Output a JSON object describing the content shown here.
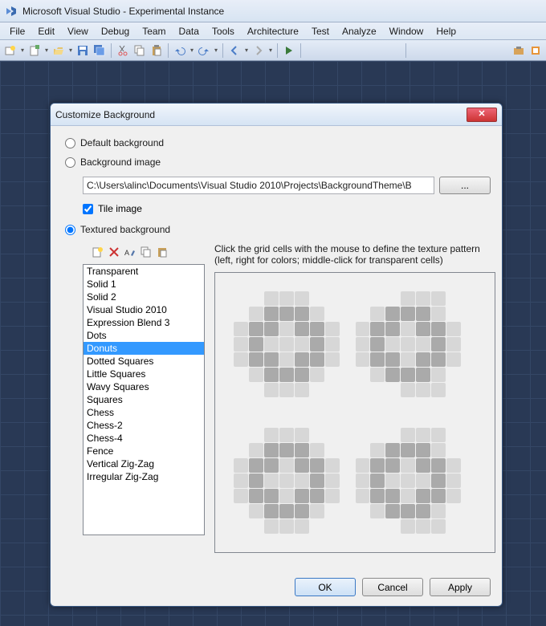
{
  "window": {
    "title": "Microsoft Visual Studio - Experimental Instance"
  },
  "menu": {
    "items": [
      "File",
      "Edit",
      "View",
      "Debug",
      "Team",
      "Data",
      "Tools",
      "Architecture",
      "Test",
      "Analyze",
      "Window",
      "Help"
    ]
  },
  "dialog": {
    "title": "Customize Background",
    "options": {
      "default_label": "Default background",
      "image_label": "Background image",
      "textured_label": "Textured background",
      "selected": "textured"
    },
    "image_path": "C:\\Users\\alinc\\Documents\\Visual Studio 2010\\Projects\\BackgroundTheme\\B",
    "browse_label": "...",
    "tile_label": "Tile image",
    "tile_checked": true,
    "hint": "Click the grid cells with the mouse to define the texture pattern (left, right for colors; middle-click for transparent cells)",
    "presets": [
      "Transparent",
      "Solid 1",
      "Solid 2",
      "Visual Studio 2010",
      "Expression Blend 3",
      "Dots",
      "Donuts",
      "Dotted Squares",
      "Little Squares",
      "Wavy Squares",
      "Squares",
      "Chess",
      "Chess-2",
      "Chess-4",
      "Fence",
      "Vertical Zig-Zag",
      "Irregular Zig-Zag"
    ],
    "selected_preset": "Donuts",
    "buttons": {
      "ok": "OK",
      "cancel": "Cancel",
      "apply": "Apply"
    },
    "grid_pattern": [
      "000000000000000000",
      "000111000000111000",
      "001222100012221000",
      "012212210122122100",
      "012111210121112100",
      "012212210122122100",
      "001222100012221000",
      "000111000000111000",
      "000000000000000000",
      "000000000000000000",
      "000111000000111000",
      "001222100012221000",
      "012212210122122100",
      "012111210121112100",
      "012212210122122100",
      "001222100012221000",
      "000111000000111000",
      "000000000000000000"
    ]
  }
}
